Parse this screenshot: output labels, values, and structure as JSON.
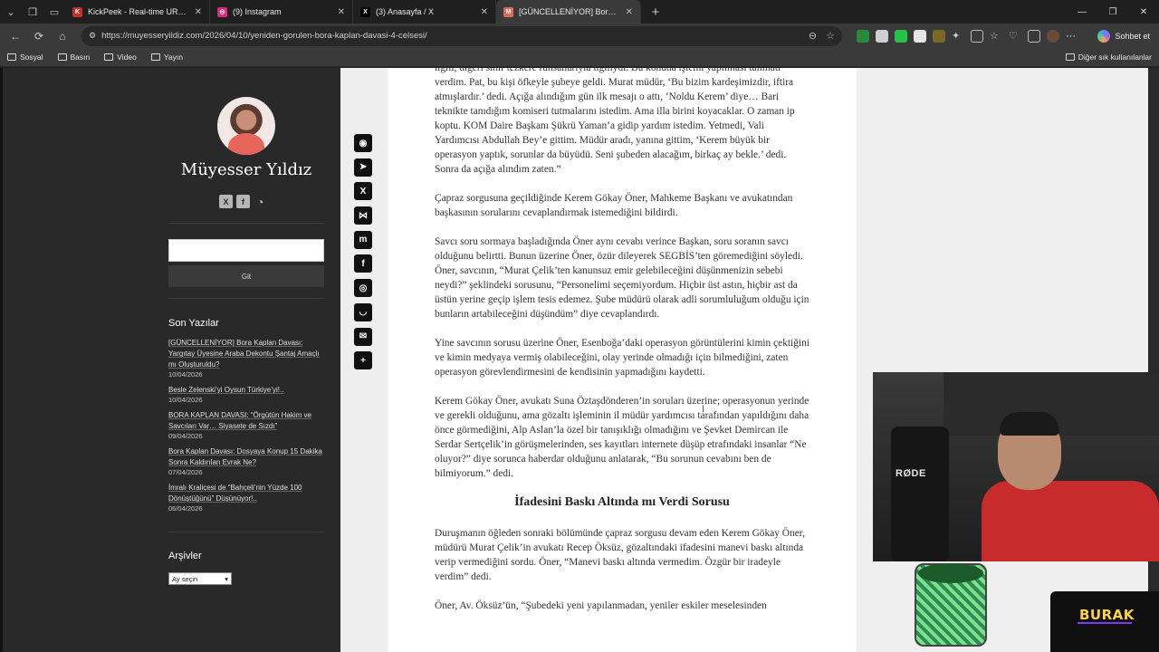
{
  "tabs": [
    {
      "title": "KickPeek - Real-time URL Crawler",
      "color": "#c23030",
      "glyph": "K",
      "active": false
    },
    {
      "title": "(9) Instagram",
      "color": "#d6297a",
      "glyph": "◎",
      "active": false
    },
    {
      "title": "(3) Anasayfa / X",
      "color": "#000000",
      "glyph": "X",
      "active": false
    },
    {
      "title": "[GÜNCELLENİYOR] Bora Kaplan Da",
      "color": "#e06a5a",
      "glyph": "M",
      "active": true
    }
  ],
  "address": {
    "url": "https://muyesseryildiz.com/2026/04/10/yeniden-gorulen-bora-kaplan-davasi-4-celsesi/",
    "chat_label": "Sohbet et"
  },
  "bookmarks": {
    "items": [
      "Sosyal",
      "Basın",
      "Video",
      "Yayın"
    ],
    "other": "Diğer sık kullanılanlar"
  },
  "sidebar": {
    "site_title": "Müyesser Yıldız",
    "search_button": "Git",
    "recent_title": "Son Yazılar",
    "recent": [
      {
        "title": "[GÜNCELLENİYOR] Bora Kaplan Davası: Yargıtay Üyesine Araba Dekontu Şantaj Amaçlı mı Oluşturuldu?",
        "date": "10/04/2026"
      },
      {
        "title": "Besle Zelenski’yi Oysun Türkiye’yi!..",
        "date": "10/04/2026"
      },
      {
        "title": "BORA KAPLAN DAVASI: “Örgütün Hakim ve Savcıları Var… Siyasete de Sızdı”",
        "date": "09/04/2026"
      },
      {
        "title": "Bora Kaplan Davası: Dosyaya Konup 15 Dakika Sonra Kaldırılan Evrak Ne?",
        "date": "07/04/2026"
      },
      {
        "title": "İmralı Kraliçesi de “Bahçeli’nin Yüzde 100 Dönüştüğünü” Düşünüyor!..",
        "date": "06/04/2026"
      }
    ],
    "archive_title": "Arşivler",
    "archive_select": "Ay seçin"
  },
  "share_icons": [
    "whatsapp-icon",
    "telegram-icon",
    "x-icon",
    "bluesky-icon",
    "mastodon-icon",
    "facebook-icon",
    "reddit-icon",
    "pocket-icon",
    "email-icon",
    "add-icon"
  ],
  "article": {
    "p1": "ilgili, diğeri sınır tezkere ruhsatlarıyla ilgiliydi. Bu konuda işlemi yapılması talimatı verdim. Pat, bu kişi öfkeyle şubeye geldi. Murat müdür, ‘Bu bizim kardeşimizdir, iftira atmışlardır.’ dedi. Açığa alındığım gün ilk mesajı o attı, ‘Noldu Kerem’ diye… Bari teknikte tanıdığım komiseri tutmalarını istedim. Ama illa birini koyacaklar. O zaman ip koptu. KOM Daire Başkanı Şükrü Yaman’a gidip yardım istedim. Yetmedi, Vali Yardımcısı Abdullah Bey’e gittim. Müdür aradı, yanına gittim, ‘Kerem büyük bir operasyon yaptık, sorunlar da büyüdü. Seni şubeden alacağım, birkaç ay bekle.’ dedi. Sonra da açığa alındım zaten.”",
    "p2": "Çapraz sorgusuna geçildiğinde Kerem Gökay Öner, Mahkeme Başkanı ve avukatından başkasının sorularını cevaplandırmak istemediğini bildirdi.",
    "p3": "Savcı soru sormaya başladığında Öner aynı cevabı verince Başkan, soru soranın savcı olduğunu belirtti. Bunun üzerine Öner, özür dileyerek SEGBİS’ten göremediğini söyledi. Öner, savcının, “Murat Çelik’ten kanunsuz emir gelebileceğini düşünmenizin sebebi neydi?” şeklindeki sorusunu, “Personelimi seçemiyordum. Hiçbir üst astın, hiçbir ast da üstün yerine geçip işlem tesis edemez. Şube müdürü olarak adli sorumluluğum olduğu için bunların artabileceğini düşündüm” diye cevaplandırdı.",
    "p4": "Yine savcının sorusu üzerine Öner, Esenboğa’daki operasyon görüntülerini kimin çektiğini ve kimin medyaya vermiş olabileceğini, olay yerinde olmadığı için bilmediğini, zaten operasyon görevlendirmesini de kendisinin yapmadığını kaydetti.",
    "p5": "Kerem Gökay Öner, avukatı Suna Öztaşdönderen’in soruları üzerine; operasyonun yerinde ve gerekli olduğunu, ama gözaltı işleminin il müdür yardımcısı tarafından yapıldığını daha önce görmediğini, Alp Aslan’la özel bir tanışıklığı olmadığını ve Şevket Demircan ile Serdar Sertçelik’in görüşmelerinden, ses kayıtları internete düşüp etrafındaki insanlar “Ne oluyor?” diye sorunca haberdar olduğunu anlatarak, “Bu sorunun cevabını ben de bilmiyorum.” dedi.",
    "heading": "İfadesini Baskı Altında mı Verdi Sorusu",
    "p6": "Duruşmanın öğleden sonraki bölümünde çapraz sorgusu devam eden Kerem Gökay Öner, müdürü Murat Çelik’in avukatı Recep Öksüz, gözaltındaki ifadesini manevi baskı altında verip vermediğini sordu. Öner, “Manevi baskı altında vermedim. Özgür bir iradeyle verdim” dedi.",
    "p7": "Öner, Av. Öksüz’ün, “Şubedeki yeni yapılanmadan, yeniler eskiler meselesinden"
  },
  "overlay": {
    "cam_brand": "RØDE",
    "streamer": "BURAK"
  }
}
